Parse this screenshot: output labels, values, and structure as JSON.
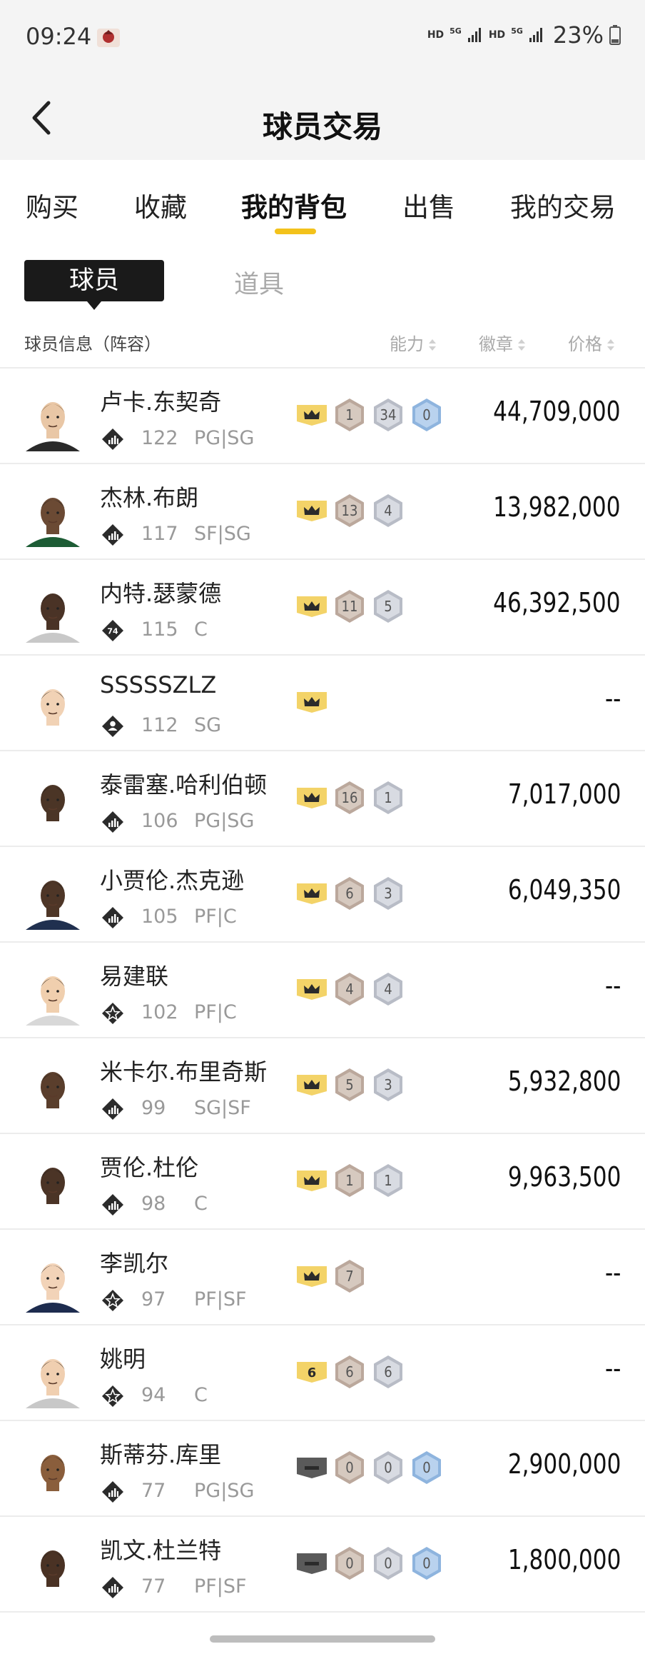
{
  "status_bar": {
    "time": "09:24",
    "network": [
      "HD",
      "5G",
      "HD",
      "5G"
    ],
    "battery": "23%"
  },
  "header": {
    "title": "球员交易"
  },
  "tabs": [
    "购买",
    "收藏",
    "我的背包",
    "出售",
    "我的交易"
  ],
  "active_tab": "我的背包",
  "subtabs": {
    "active": "球员",
    "inactive": "道具"
  },
  "columns": {
    "info": "球员信息（阵容）",
    "ability": "能力",
    "badges": "徽章",
    "price": "价格"
  },
  "colors": {
    "accent": "#f3c21b",
    "badge_bronze": "#bba89c",
    "badge_silver": "#b8bcc6",
    "badge_blue": "#8eb4de",
    "crown_gold": "#f3d368",
    "crown_gray": "#5a5a5a"
  },
  "players": [
    {
      "name": "卢卡.东契奇",
      "rating": "122",
      "position": "PG|SG",
      "tier": "chart-icon",
      "crown": "gold",
      "badges": [
        {
          "type": "bronze",
          "n": "1"
        },
        {
          "type": "silver",
          "n": "34"
        },
        {
          "type": "blue",
          "n": "0"
        }
      ],
      "price": "44,709,000"
    },
    {
      "name": "杰林.布朗",
      "rating": "117",
      "position": "SF|SG",
      "tier": "chart-icon",
      "crown": "gold",
      "badges": [
        {
          "type": "bronze",
          "n": "13"
        },
        {
          "type": "silver",
          "n": "4"
        }
      ],
      "price": "13,982,000"
    },
    {
      "name": "内特.瑟蒙德",
      "rating": "115",
      "position": "C",
      "tier": "seventy-four-icon",
      "crown": "gold",
      "badges": [
        {
          "type": "bronze",
          "n": "11"
        },
        {
          "type": "silver",
          "n": "5"
        }
      ],
      "price": "46,392,500"
    },
    {
      "name": "SSSSSZLZ",
      "rating": "112",
      "position": "SG",
      "tier": "person-icon",
      "crown": "gold",
      "badges": [],
      "price": "--"
    },
    {
      "name": "泰雷塞.哈利伯顿",
      "rating": "106",
      "position": "PG|SG",
      "tier": "chart-icon",
      "crown": "gold",
      "badges": [
        {
          "type": "bronze",
          "n": "16"
        },
        {
          "type": "silver",
          "n": "1"
        }
      ],
      "price": "7,017,000"
    },
    {
      "name": "小贾伦.杰克逊",
      "rating": "105",
      "position": "PF|C",
      "tier": "chart-icon",
      "crown": "gold",
      "badges": [
        {
          "type": "bronze",
          "n": "6"
        },
        {
          "type": "silver",
          "n": "3"
        }
      ],
      "price": "6,049,350"
    },
    {
      "name": "易建联",
      "rating": "102",
      "position": "PF|C",
      "tier": "star-icon",
      "crown": "gold",
      "badges": [
        {
          "type": "bronze",
          "n": "4"
        },
        {
          "type": "silver",
          "n": "4"
        }
      ],
      "price": "--"
    },
    {
      "name": "米卡尔.布里奇斯",
      "rating": "99",
      "position": "SG|SF",
      "tier": "chart-icon",
      "crown": "gold",
      "badges": [
        {
          "type": "bronze",
          "n": "5"
        },
        {
          "type": "silver",
          "n": "3"
        }
      ],
      "price": "5,932,800"
    },
    {
      "name": "贾伦.杜伦",
      "rating": "98",
      "position": "C",
      "tier": "chart-icon",
      "crown": "gold",
      "badges": [
        {
          "type": "bronze",
          "n": "1"
        },
        {
          "type": "silver",
          "n": "1"
        }
      ],
      "price": "9,963,500"
    },
    {
      "name": "李凯尔",
      "rating": "97",
      "position": "PF|SF",
      "tier": "star-icon",
      "crown": "gold",
      "badges": [
        {
          "type": "bronze",
          "n": "7"
        }
      ],
      "price": "--"
    },
    {
      "name": "姚明",
      "rating": "94",
      "position": "C",
      "tier": "star-icon",
      "crown": "gold-six",
      "crown_label": "6",
      "badges": [
        {
          "type": "bronze",
          "n": "6"
        },
        {
          "type": "silver",
          "n": "6"
        }
      ],
      "price": "--"
    },
    {
      "name": "斯蒂芬.库里",
      "rating": "77",
      "position": "PG|SG",
      "tier": "chart-icon",
      "crown": "gray",
      "badges": [
        {
          "type": "bronze",
          "n": "0"
        },
        {
          "type": "silver",
          "n": "0"
        },
        {
          "type": "blue",
          "n": "0"
        }
      ],
      "price": "2,900,000"
    },
    {
      "name": "凯文.杜兰特",
      "rating": "77",
      "position": "PF|SF",
      "tier": "chart-icon",
      "crown": "gray",
      "badges": [
        {
          "type": "bronze",
          "n": "0"
        },
        {
          "type": "silver",
          "n": "0"
        },
        {
          "type": "blue",
          "n": "0"
        }
      ],
      "price": "1,800,000"
    }
  ]
}
